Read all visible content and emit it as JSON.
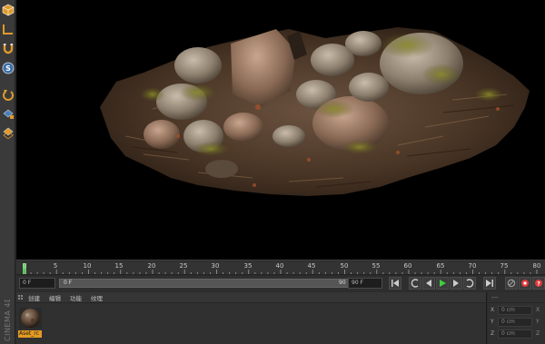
{
  "toolbar": {
    "icons": [
      "cube-icon",
      "corner-icon",
      "magnet-icon",
      "s-snap-icon",
      "undo-icon",
      "lock-grid-icon",
      "grid-icon"
    ]
  },
  "timeline": {
    "ticks": [
      "0",
      "5",
      "10",
      "15",
      "20",
      "25",
      "30",
      "35",
      "40",
      "45",
      "50",
      "55",
      "60",
      "65",
      "70",
      "75",
      "80"
    ],
    "current_frame": 0
  },
  "transport": {
    "start_field": "0 F",
    "slider_left": "0 F",
    "slider_right": "90 F",
    "end_field": "90 F",
    "accent_play": "#3ecf3e",
    "accent_record": "#e03a3a"
  },
  "materials": {
    "menu": [
      "创建",
      "编辑",
      "功能",
      "纹理"
    ],
    "items": [
      {
        "name": "Aset_rc"
      }
    ]
  },
  "brand": {
    "text": "CINEMA 4D"
  },
  "coordinates": {
    "header": "---",
    "rows": [
      {
        "axis": "X",
        "value": "0 cm",
        "extra": "X"
      },
      {
        "axis": "Y",
        "value": "0 cm",
        "extra": "Y"
      },
      {
        "axis": "Z",
        "value": "0 cm",
        "extra": "Z"
      }
    ]
  }
}
